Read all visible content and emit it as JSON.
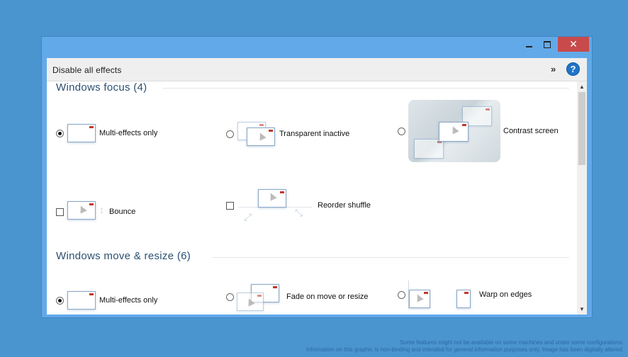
{
  "window": {
    "controls": {
      "minimize": "",
      "maximize": "",
      "close": "✕"
    }
  },
  "toolbar": {
    "disable_label": "Disable all effects",
    "more_icon": "»",
    "help_icon": "?"
  },
  "sections": {
    "focus": {
      "title": "Windows focus (4)",
      "options": {
        "multi_effects": {
          "label": "Multi-effects only",
          "control": "radio",
          "checked": true
        },
        "transparent_inactive": {
          "label": "Transparent inactive",
          "control": "radio",
          "checked": false
        },
        "contrast_screen": {
          "label": "Contrast screen",
          "control": "radio",
          "checked": false
        },
        "bounce": {
          "label": "Bounce",
          "control": "checkbox",
          "checked": false
        },
        "reorder_shuffle": {
          "label": "Reorder shuffle",
          "control": "checkbox",
          "checked": false
        }
      }
    },
    "move_resize": {
      "title": "Windows move & resize (6)",
      "options": {
        "multi_effects": {
          "label": "Multi-effects only",
          "control": "radio",
          "checked": true
        },
        "fade_move_resize": {
          "label": "Fade on move or resize",
          "control": "radio",
          "checked": false
        },
        "warp_edges": {
          "label": "Warp on edges",
          "control": "radio",
          "checked": false
        }
      }
    }
  },
  "scrollbar": {
    "up": "▲",
    "down": "▼"
  },
  "footnote": {
    "line1": "Some features might not be available on some machines and under some configurations.",
    "line2": "Information on this graphic is non-binding and intended for general information purposes only.  Image has been digitally altered."
  },
  "colors": {
    "desktop": "#4a95cf",
    "frame": "#62a9e9",
    "close_button": "#c84a4a",
    "section_title": "#2b4f72",
    "help_icon": "#1f74c8"
  }
}
